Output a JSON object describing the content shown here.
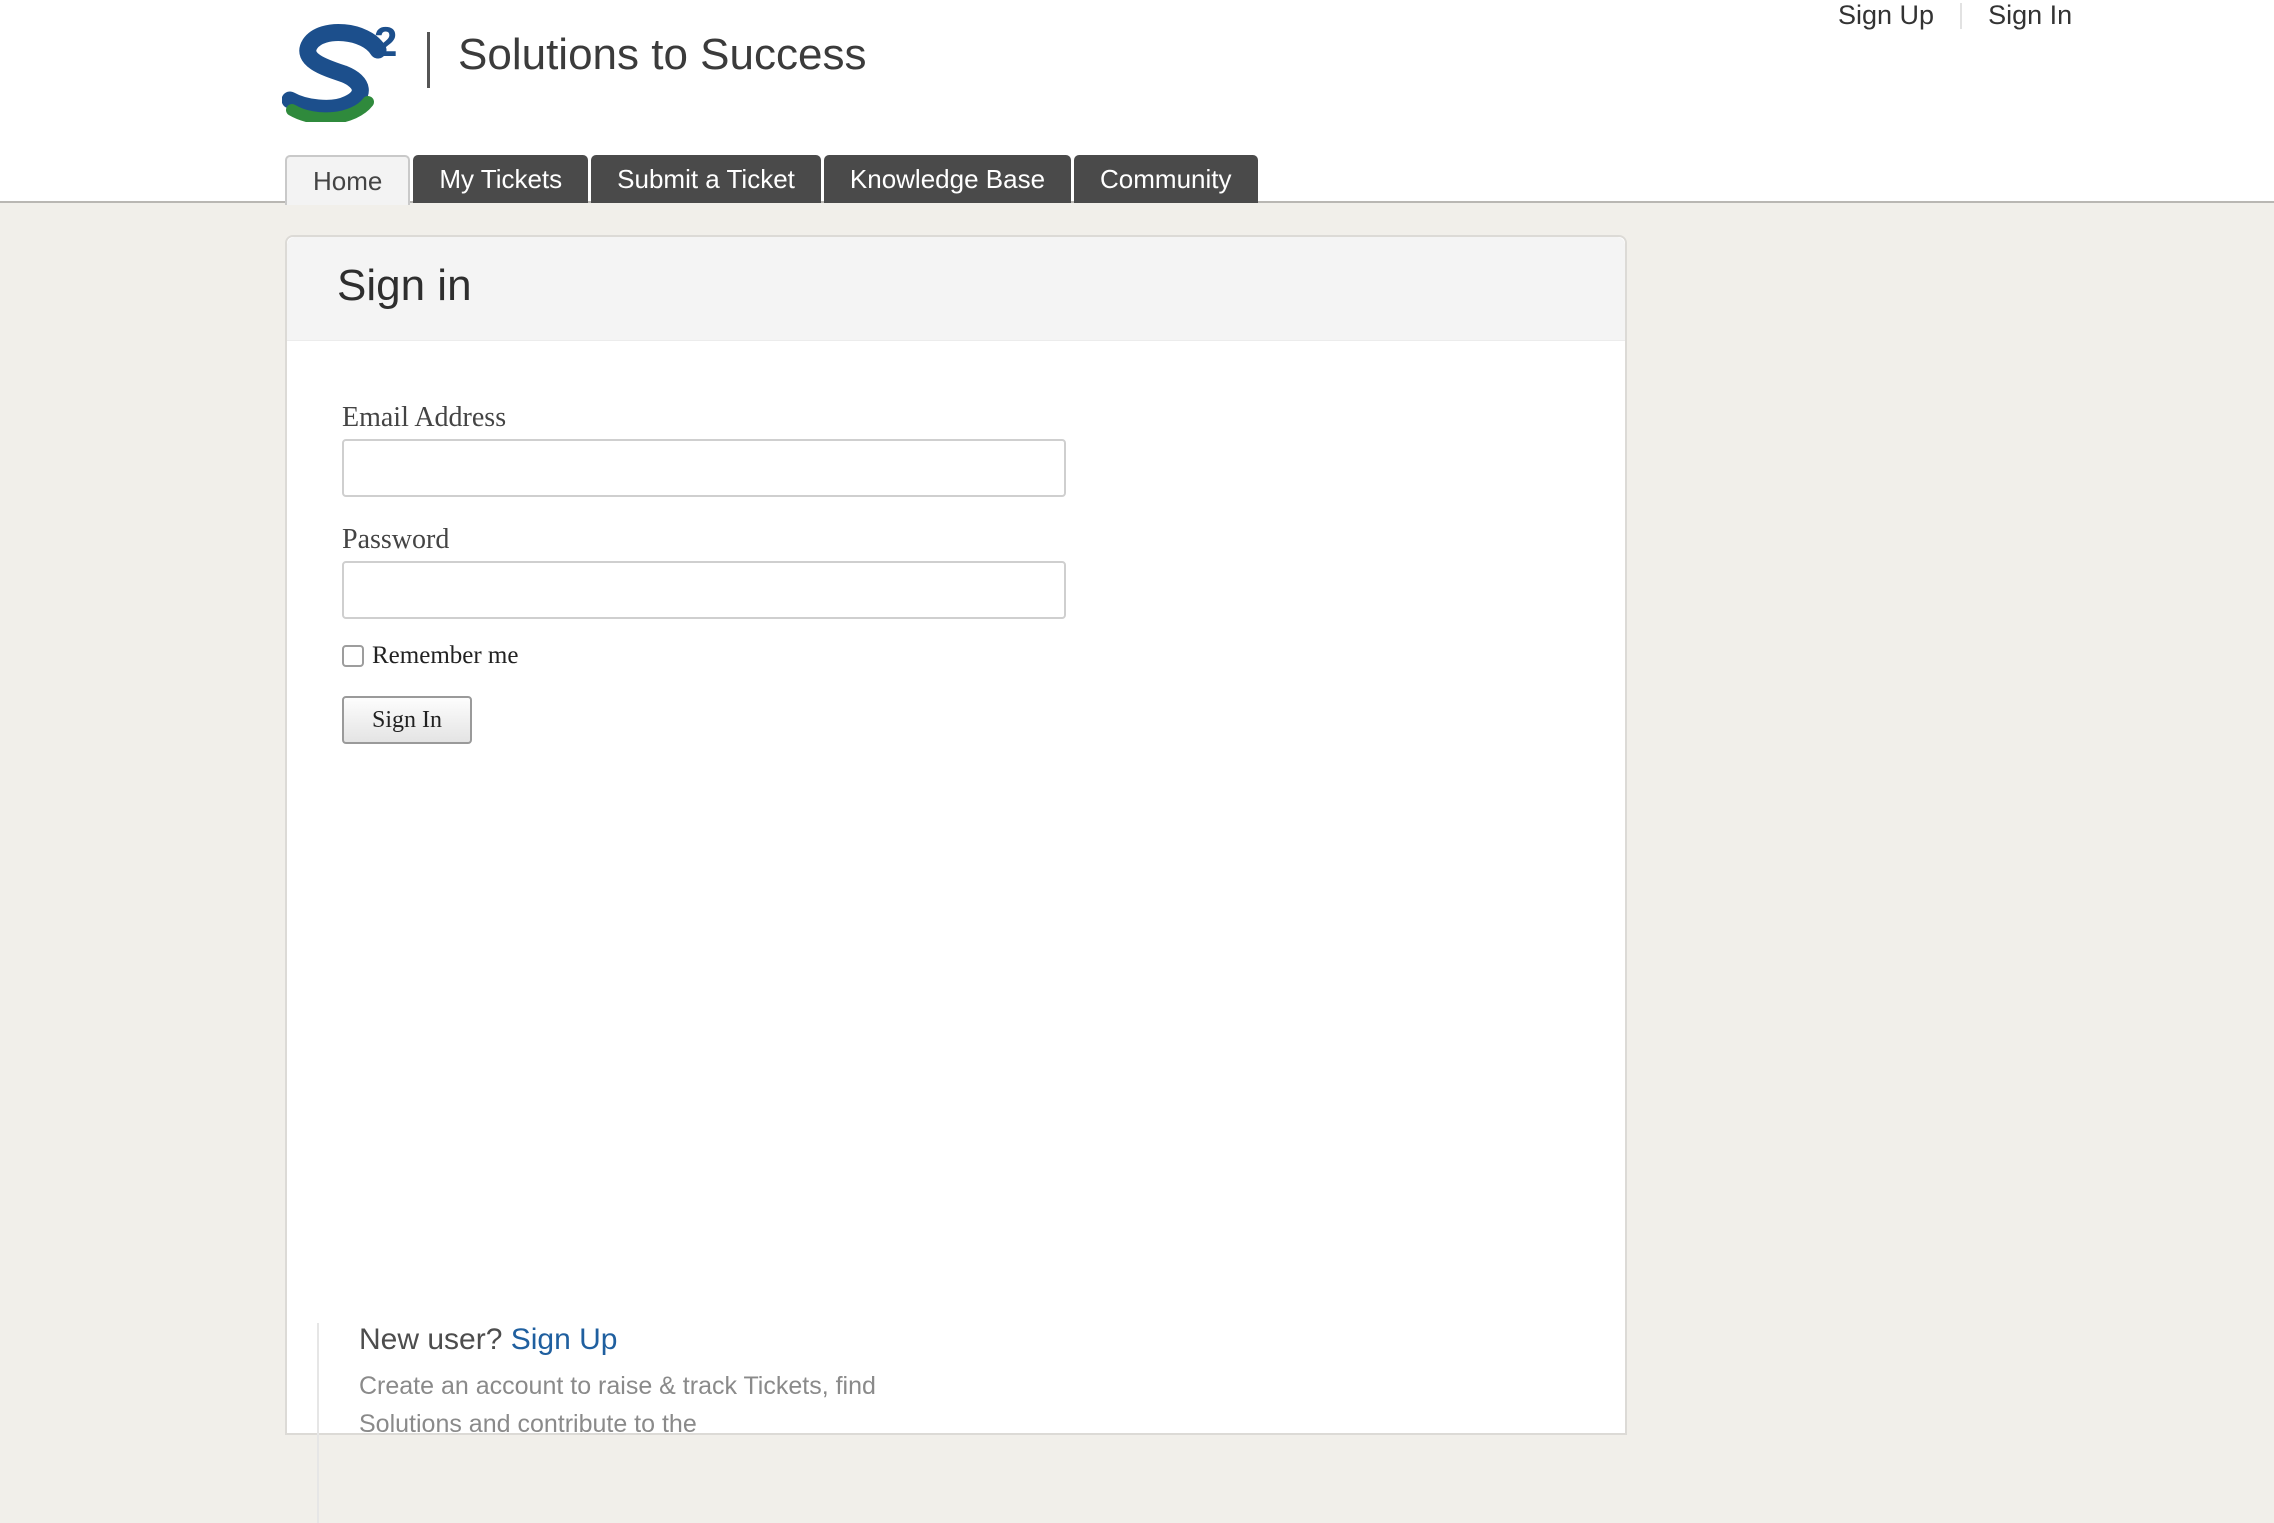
{
  "header": {
    "site_title": "Solutions to Success",
    "logo_icon": "s2-logo-icon",
    "top_links": [
      "Sign Up",
      "Sign In"
    ]
  },
  "tabs": [
    {
      "label": "Home",
      "active": true
    },
    {
      "label": "My Tickets",
      "active": false
    },
    {
      "label": "Submit a Ticket",
      "active": false
    },
    {
      "label": "Knowledge Base",
      "active": false
    },
    {
      "label": "Community",
      "active": false
    }
  ],
  "signin": {
    "title": "Sign in",
    "email_label": "Email Address",
    "email_value": "",
    "password_label": "Password",
    "password_value": "",
    "remember_label": "Remember me",
    "remember_checked": false,
    "submit_label": "Sign In"
  },
  "newuser": {
    "prompt": "New user?",
    "link": "Sign Up",
    "description": "Create an account to raise & track Tickets, find Solutions and contribute to the"
  },
  "colors": {
    "page_bg": "#f1efea",
    "tab_bg": "#4a4a4a",
    "link": "#1f5f9f",
    "logo_blue": "#1c4f8c",
    "logo_green": "#2f8a3c"
  }
}
